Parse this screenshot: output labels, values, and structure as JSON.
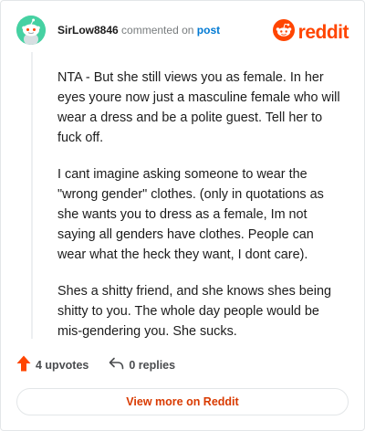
{
  "header": {
    "username": "SirLow8846",
    "action_text": "commented on",
    "post_link": "post"
  },
  "brand": {
    "name": "reddit",
    "icon": "reddit-alien-icon",
    "color": "#ff4500"
  },
  "avatar": {
    "icon": "snoo-avatar-icon",
    "color": "#46d1a2"
  },
  "comment": {
    "paragraphs": [
      "NTA - But she still views you as female. In her eyes youre now just a masculine female who will wear a dress and be a polite guest. Tell her to fuck off.",
      "I cant imagine asking someone to wear the \"wrong gender\" clothes. (only in quotations as she wants you to dress as a female, Im not saying all genders have clothes. People can wear what the heck they want, I dont care).",
      "Shes a shitty friend, and she knows shes being shitty to you. The whole day people would be mis-gendering you. She sucks."
    ]
  },
  "actions": {
    "upvotes_label": "4 upvotes",
    "upvote_icon": "upvote-arrow-icon",
    "replies_label": "0 replies",
    "reply_icon": "reply-arrow-icon"
  },
  "footer": {
    "view_more_label": "View more on Reddit"
  }
}
